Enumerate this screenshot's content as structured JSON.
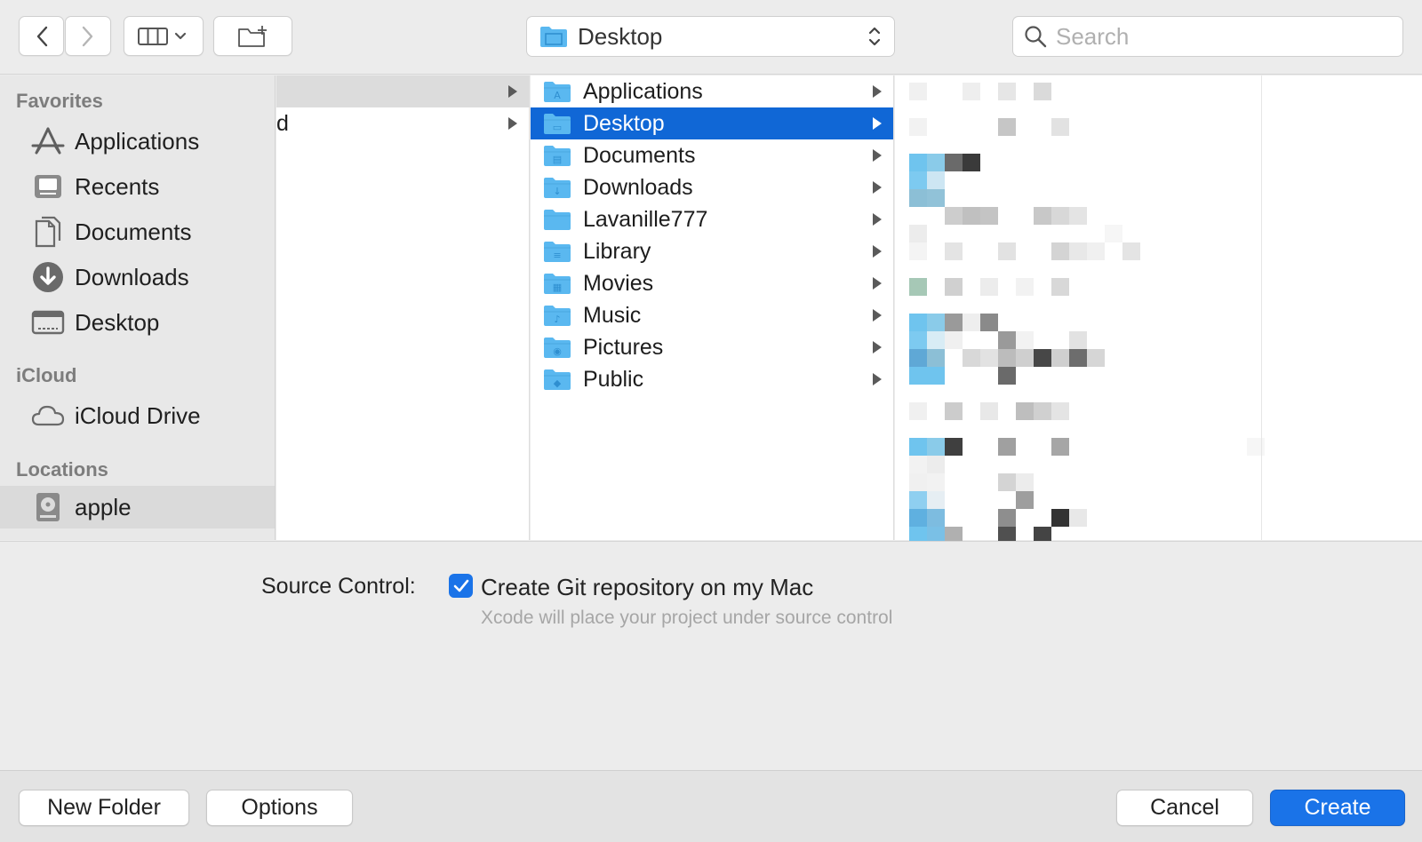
{
  "toolbar": {
    "back_icon": "chevron-left-icon",
    "forward_icon": "chevron-right-icon",
    "view_icon": "column-view-icon",
    "new_folder_icon": "new-folder-icon",
    "location": "Desktop",
    "search_placeholder": "Search"
  },
  "sidebar": {
    "sections": [
      {
        "title": "Favorites",
        "items": [
          {
            "label": "Applications",
            "icon": "applications-icon"
          },
          {
            "label": "Recents",
            "icon": "recents-icon"
          },
          {
            "label": "Documents",
            "icon": "documents-icon"
          },
          {
            "label": "Downloads",
            "icon": "downloads-icon"
          },
          {
            "label": "Desktop",
            "icon": "desktop-icon"
          }
        ]
      },
      {
        "title": "iCloud",
        "items": [
          {
            "label": "iCloud Drive",
            "icon": "cloud-icon"
          }
        ]
      },
      {
        "title": "Locations",
        "items": [
          {
            "label": "apple",
            "icon": "hard-drive-icon",
            "selected": true
          }
        ]
      }
    ]
  },
  "browser": {
    "column1": [
      {
        "label": "",
        "selected": true
      },
      {
        "label": "d",
        "selected": false
      }
    ],
    "column2": [
      {
        "label": "Applications",
        "selected": false
      },
      {
        "label": "Desktop",
        "selected": true
      },
      {
        "label": "Documents",
        "selected": false
      },
      {
        "label": "Downloads",
        "selected": false
      },
      {
        "label": "Lavanille777",
        "selected": false
      },
      {
        "label": "Library",
        "selected": false
      },
      {
        "label": "Movies",
        "selected": false
      },
      {
        "label": "Music",
        "selected": false
      },
      {
        "label": "Pictures",
        "selected": false
      },
      {
        "label": "Public",
        "selected": false
      }
    ]
  },
  "options": {
    "source_control_label": "Source Control:",
    "git_checkbox_label": "Create Git repository on my Mac",
    "git_checkbox_checked": true,
    "git_help": "Xcode will place your project under source control"
  },
  "buttons": {
    "new_folder": "New Folder",
    "options": "Options",
    "cancel": "Cancel",
    "create": "Create"
  },
  "colors": {
    "accent": "#1a73e8",
    "selection": "#1067d6",
    "folder": "#5ab8f0"
  }
}
